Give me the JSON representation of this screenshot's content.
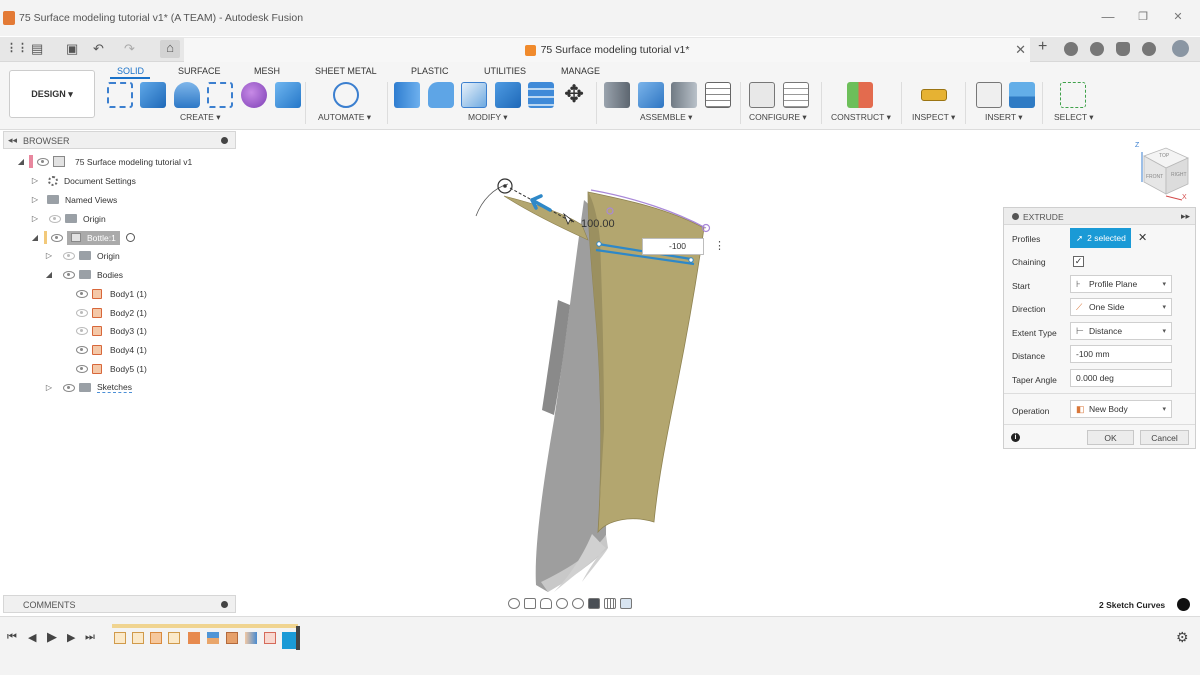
{
  "window": {
    "title": "75 Surface modeling tutorial v1* (A TEAM) - Autodesk Fusion",
    "minimize_glyph": "—",
    "restore_glyph": "❐",
    "close_glyph": "✕"
  },
  "doc_tab": {
    "label": "75 Surface modeling tutorial v1*",
    "close_glyph": "✕"
  },
  "quick_access": {
    "grid_glyph": "⋮⋮",
    "file_glyph": "▤",
    "save_glyph": "▣",
    "undo_glyph": "↶",
    "redo_glyph": "↷",
    "home_glyph": "⌂",
    "new_tab_glyph": "+"
  },
  "ribbon": {
    "workspace": "DESIGN ▾",
    "tabs": [
      "SOLID",
      "SURFACE",
      "MESH",
      "SHEET METAL",
      "PLASTIC",
      "UTILITIES",
      "MANAGE"
    ],
    "groups": {
      "create": "CREATE ▾",
      "automate": "AUTOMATE ▾",
      "modify": "MODIFY ▾",
      "assemble": "ASSEMBLE ▾",
      "configure": "CONFIGURE ▾",
      "construct": "CONSTRUCT ▾",
      "inspect": "INSPECT ▾",
      "insert": "INSERT ▾",
      "select": "SELECT ▾"
    }
  },
  "browser": {
    "title": "BROWSER",
    "collapse_glyph": "◂◂",
    "items": [
      {
        "label": "75 Surface modeling tutorial v1"
      },
      {
        "label": "Document Settings"
      },
      {
        "label": "Named Views"
      },
      {
        "label": "Origin"
      },
      {
        "label": "Bottle:1"
      },
      {
        "label": "Origin"
      },
      {
        "label": "Bodies"
      },
      {
        "label": "Body1 (1)"
      },
      {
        "label": "Body2 (1)"
      },
      {
        "label": "Body3 (1)"
      },
      {
        "label": "Body4 (1)"
      },
      {
        "label": "Body5 (1)"
      },
      {
        "label": "Sketches"
      }
    ]
  },
  "viewport": {
    "dimension_label": "100.00",
    "distance_input": "-100",
    "more_glyph": "⋮",
    "viewcube_axis_z": "Z",
    "viewcube_axis_x": "X",
    "viewcube_face_top": "TOP",
    "viewcube_face_front": "FRONT",
    "viewcube_face_right": "RIGHT"
  },
  "extrude": {
    "title": "EXTRUDE",
    "pin_glyph": "▸▸",
    "profiles_label": "Profiles",
    "profiles_value": "2 selected",
    "profiles_clear": "✕",
    "chaining_label": "Chaining",
    "chaining_check": "✓",
    "start_label": "Start",
    "start_value": "Profile Plane",
    "direction_label": "Direction",
    "direction_value": "One Side",
    "extent_label": "Extent Type",
    "extent_value": "Distance",
    "distance_label": "Distance",
    "distance_value": "-100 mm",
    "taper_label": "Taper Angle",
    "taper_value": "0.000 deg",
    "operation_label": "Operation",
    "operation_value": "New Body",
    "ok": "OK",
    "cancel": "Cancel",
    "info_glyph": "i",
    "caret": "▾"
  },
  "comments": {
    "title": "COMMENTS"
  },
  "status": {
    "selection": "2 Sketch Curves"
  },
  "timeline": {
    "first": "⏮",
    "prev": "◀",
    "play": "▶",
    "next": "▶",
    "last": "⏭",
    "settings": "⚙"
  },
  "colors": {
    "accent": "#1a72c9",
    "selection": "#1a9ad6",
    "surface": "#b2a66f",
    "body_gray": "#9a9a9a"
  }
}
